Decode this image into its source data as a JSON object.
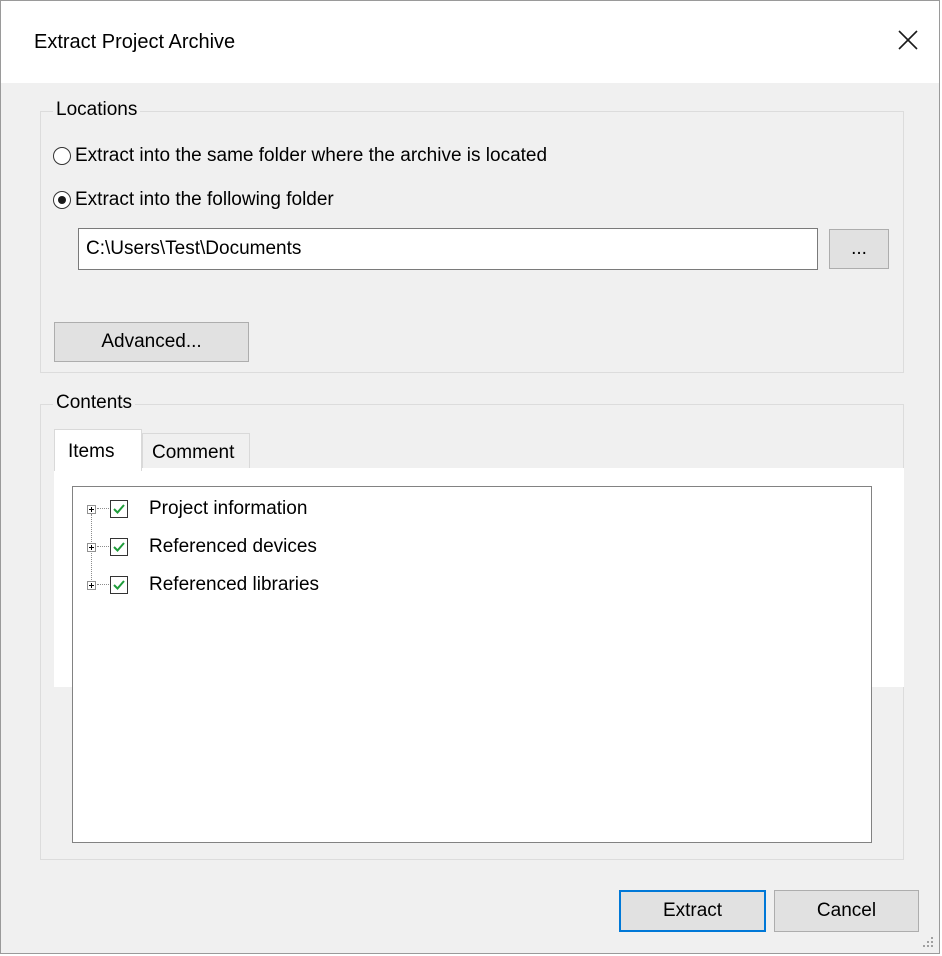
{
  "dialog": {
    "title": "Extract Project Archive",
    "close_icon": "close-icon"
  },
  "locations": {
    "legend": "Locations",
    "options": [
      {
        "label": "Extract into the same folder where the archive is located",
        "checked": false
      },
      {
        "label": "Extract into the following folder",
        "checked": true
      }
    ],
    "path_value": "C:\\Users\\Test\\Documents",
    "browse_label": "...",
    "advanced_label": "Advanced..."
  },
  "contents": {
    "legend": "Contents",
    "tabs": [
      {
        "label": "Items",
        "active": true
      },
      {
        "label": "Comment",
        "active": false
      }
    ],
    "tree_items": [
      {
        "label": "Project information",
        "checked": true
      },
      {
        "label": "Referenced devices",
        "checked": true
      },
      {
        "label": "Referenced libraries",
        "checked": true
      }
    ]
  },
  "footer": {
    "extract_label": "Extract",
    "cancel_label": "Cancel"
  },
  "colors": {
    "accent": "#0078d7",
    "checkmark": "#1e9c3a",
    "dialog_bg": "#f0f0f0"
  }
}
